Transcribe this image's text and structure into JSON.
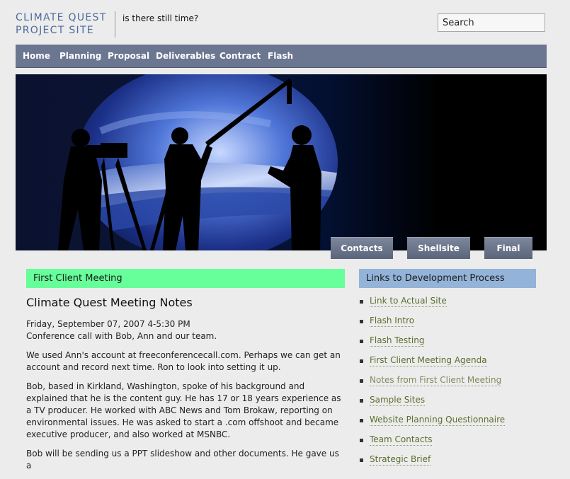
{
  "header": {
    "title_line1": "CLIMATE QUEST",
    "title_line2": "PROJECT SITE",
    "tagline": "is there still time?",
    "search_placeholder": "Search"
  },
  "nav": {
    "items": [
      "Home",
      "Planning",
      "Proposal",
      "Deliverables",
      "Contract",
      "Flash"
    ]
  },
  "hero": {
    "tabs": [
      "Contacts",
      "Shellsite",
      "Final"
    ]
  },
  "main": {
    "section_title": "First Client Meeting",
    "heading": "Climate Quest Meeting Notes",
    "paragraphs": [
      "Friday, September 07, 2007 4-5:30 PM",
      "Conference call with Bob, Ann and our team.",
      "We used Ann's account at freeconferencecall.com. Perhaps we can get an account and record next time. Ron to look into setting it up.",
      "Bob, based in Kirkland, Washington, spoke of his background and explained that he is the content guy. He has 17 or 18 years experience as a TV producer. He worked with ABC News and Tom Brokaw, reporting on environmental issues. He was asked to start a .com offshoot and became executive producer, and also worked at MSNBC.",
      "Bob will be sending us a PPT slideshow and other documents. He gave us a"
    ]
  },
  "sidebar": {
    "title": "Links to Development Process",
    "links": [
      "Link to Actual Site",
      "Flash Intro",
      "Flash Testing",
      "First Client Meeting Agenda",
      "Notes from First Client Meeting",
      "Sample Sites",
      "Website Planning Questionnaire",
      "Team Contacts",
      "Strategic Brief"
    ]
  },
  "colors": {
    "nav_bg": "#6b7690",
    "section_green": "#66ff99",
    "section_blue": "#93b3d8",
    "link": "#5b6e2e",
    "title": "#4e6a9c"
  }
}
